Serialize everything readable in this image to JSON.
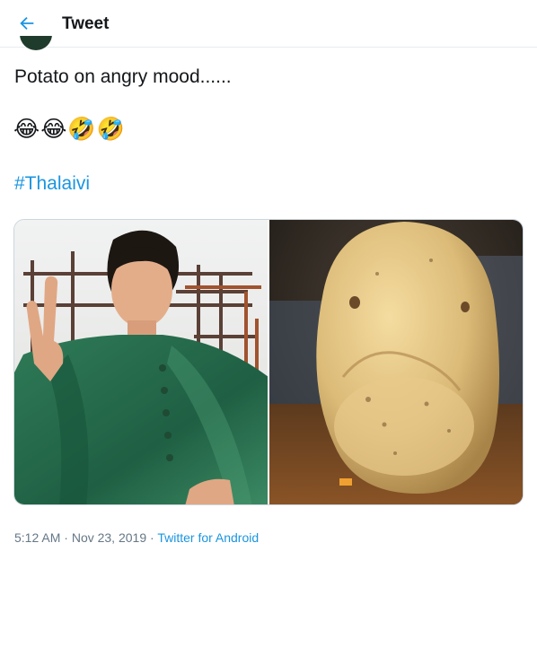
{
  "header": {
    "title": "Tweet",
    "back_icon": "arrow-left-icon",
    "accent": "#1b95e0"
  },
  "tweet": {
    "text": "Potato on angry mood......",
    "emojis": "😂😂🤣🤣",
    "hashtag": "#Thalaivi",
    "media": [
      {
        "name": "woman-green-saree-victory-sign-photo"
      },
      {
        "name": "potato-sad-face-photo"
      }
    ],
    "time": "5:12 AM",
    "date": "Nov 23, 2019",
    "separator": "·",
    "source": "Twitter for Android"
  }
}
